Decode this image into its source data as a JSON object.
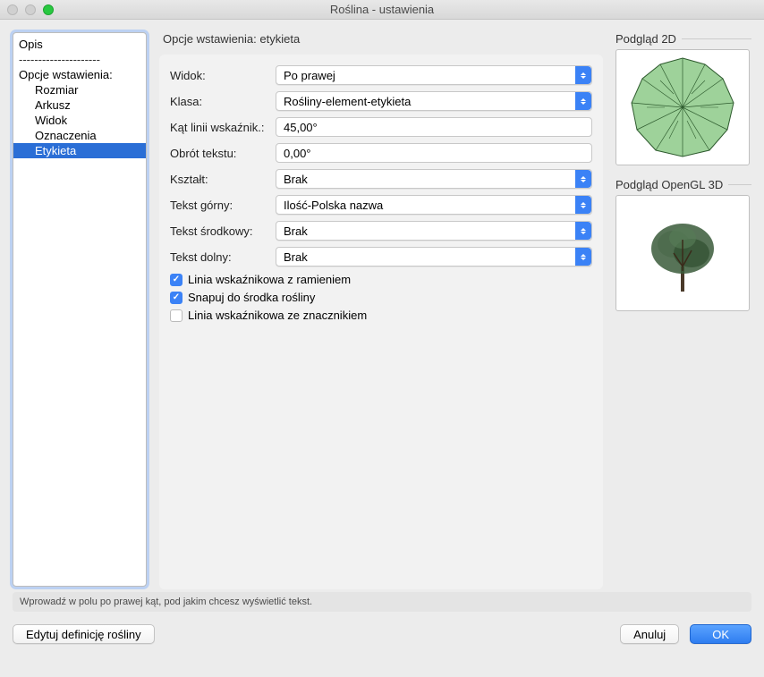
{
  "window": {
    "title": "Roślina - ustawienia"
  },
  "sidebar": {
    "items": [
      {
        "label": "Opis",
        "indent": false
      },
      {
        "label": "---------------------",
        "sep": true
      },
      {
        "label": "Opcje wstawienia:",
        "indent": false
      },
      {
        "label": "Rozmiar",
        "indent": true
      },
      {
        "label": "Arkusz",
        "indent": true
      },
      {
        "label": "Widok",
        "indent": true
      },
      {
        "label": "Oznaczenia",
        "indent": true
      },
      {
        "label": "Etykieta",
        "indent": true,
        "selected": true
      }
    ]
  },
  "section_title": "Opcje wstawienia: etykieta",
  "form": {
    "widok": {
      "label": "Widok:",
      "value": "Po prawej"
    },
    "klasa": {
      "label": "Klasa:",
      "value": "Rośliny-element-etykieta"
    },
    "kat": {
      "label": "Kąt linii wskaźnik.:",
      "value": "45,00°"
    },
    "obrot": {
      "label": "Obrót tekstu:",
      "value": "0,00°"
    },
    "ksztalt": {
      "label": "Kształt:",
      "value": "Brak"
    },
    "tekst_gorny": {
      "label": "Tekst górny:",
      "value": "Ilość-Polska nazwa"
    },
    "tekst_srodkowy": {
      "label": "Tekst środkowy:",
      "value": "Brak"
    },
    "tekst_dolny": {
      "label": "Tekst dolny:",
      "value": "Brak"
    },
    "chk1": {
      "label": "Linia wskaźnikowa z ramieniem",
      "checked": true
    },
    "chk2": {
      "label": "Snapuj do środka rośliny",
      "checked": true
    },
    "chk3": {
      "label": "Linia wskaźnikowa ze znacznikiem",
      "checked": false
    }
  },
  "previews": {
    "p2d": "Podgląd 2D",
    "p3d": "Podgląd OpenGL 3D"
  },
  "hint": "Wprowadź w polu po prawej kąt, pod jakim chcesz wyświetlić tekst.",
  "buttons": {
    "edit": "Edytuj definicję rośliny",
    "cancel": "Anuluj",
    "ok": "OK"
  }
}
